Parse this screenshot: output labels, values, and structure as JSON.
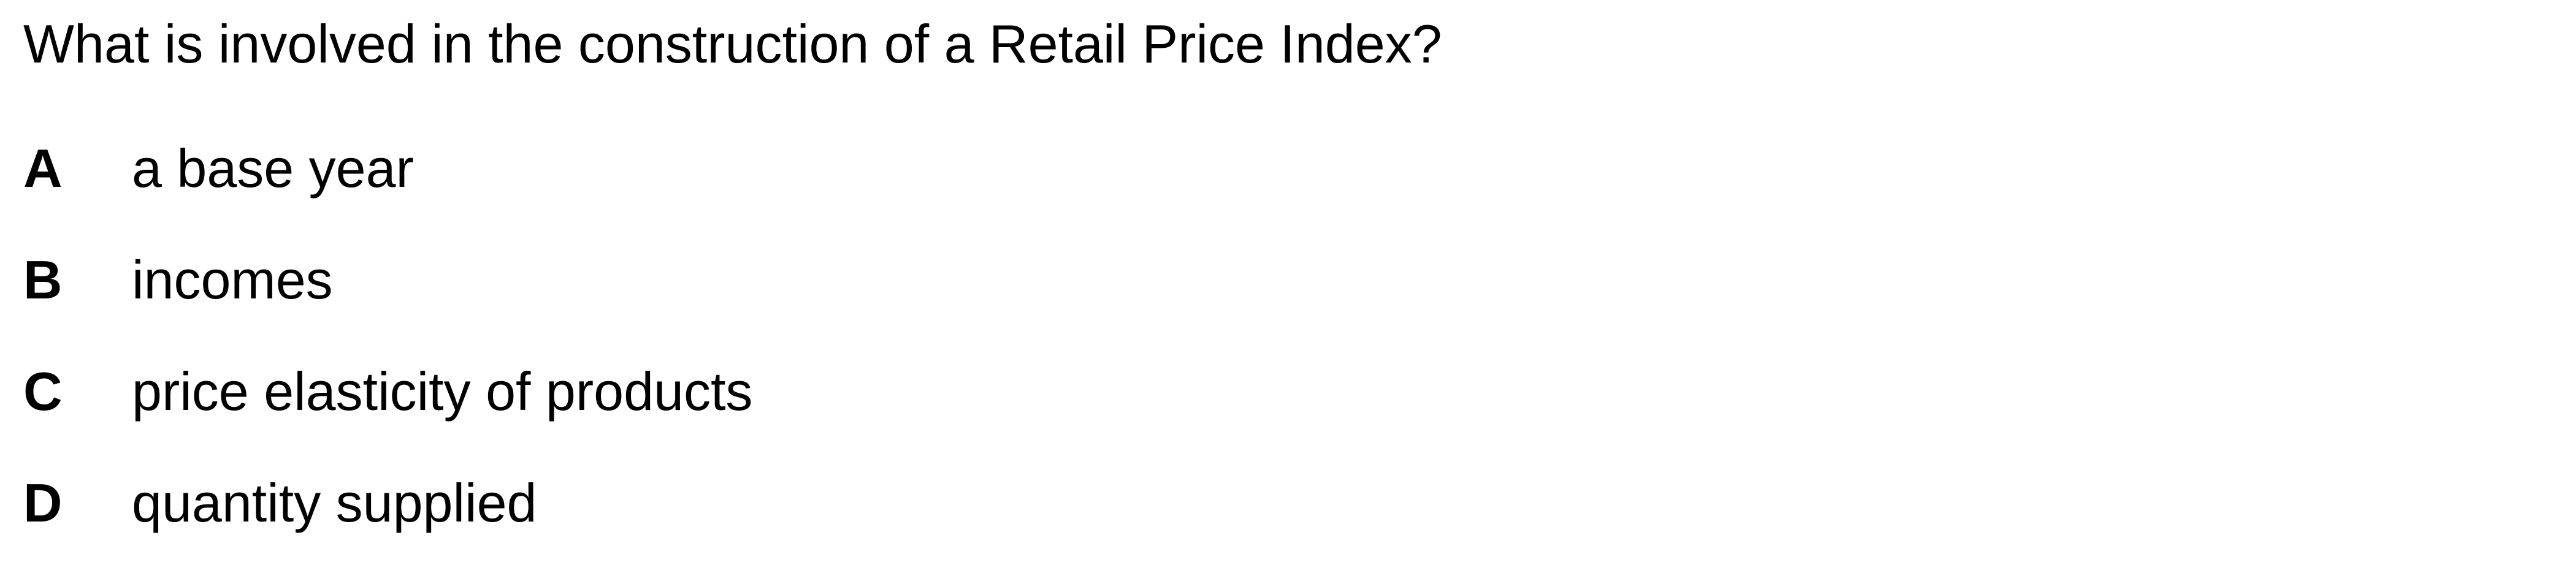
{
  "question": "What is involved in the construction of a Retail Price Index?",
  "options": [
    {
      "letter": "A",
      "text": "a base year"
    },
    {
      "letter": "B",
      "text": "incomes"
    },
    {
      "letter": "C",
      "text": "price elasticity of products"
    },
    {
      "letter": "D",
      "text": "quantity supplied"
    }
  ]
}
